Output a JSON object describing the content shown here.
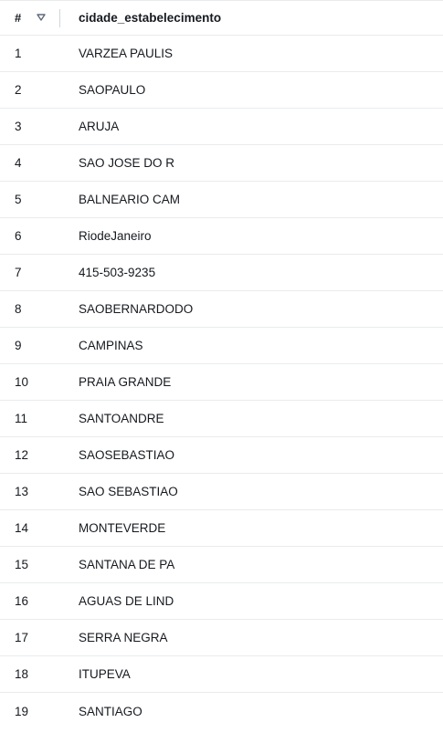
{
  "header": {
    "row_number_label": "#",
    "column_label": "cidade_estabelecimento",
    "sort_icon": "sort-triangle-down-icon"
  },
  "rows": [
    {
      "num": "1",
      "value": "VARZEA PAULIS"
    },
    {
      "num": "2",
      "value": "SAOPAULO"
    },
    {
      "num": "3",
      "value": "ARUJA"
    },
    {
      "num": "4",
      "value": "SAO JOSE DO R"
    },
    {
      "num": "5",
      "value": "BALNEARIO CAM"
    },
    {
      "num": "6",
      "value": "RiodeJaneiro"
    },
    {
      "num": "7",
      "value": "415-503-9235"
    },
    {
      "num": "8",
      "value": "SAOBERNARDODO"
    },
    {
      "num": "9",
      "value": "CAMPINAS"
    },
    {
      "num": "10",
      "value": "PRAIA GRANDE"
    },
    {
      "num": "11",
      "value": "SANTOANDRE"
    },
    {
      "num": "12",
      "value": "SAOSEBASTIAO"
    },
    {
      "num": "13",
      "value": "SAO SEBASTIAO"
    },
    {
      "num": "14",
      "value": "MONTEVERDE"
    },
    {
      "num": "15",
      "value": "SANTANA DE PA"
    },
    {
      "num": "16",
      "value": "AGUAS DE LIND"
    },
    {
      "num": "17",
      "value": "SERRA NEGRA"
    },
    {
      "num": "18",
      "value": "ITUPEVA"
    },
    {
      "num": "19",
      "value": "SANTIAGO"
    }
  ]
}
